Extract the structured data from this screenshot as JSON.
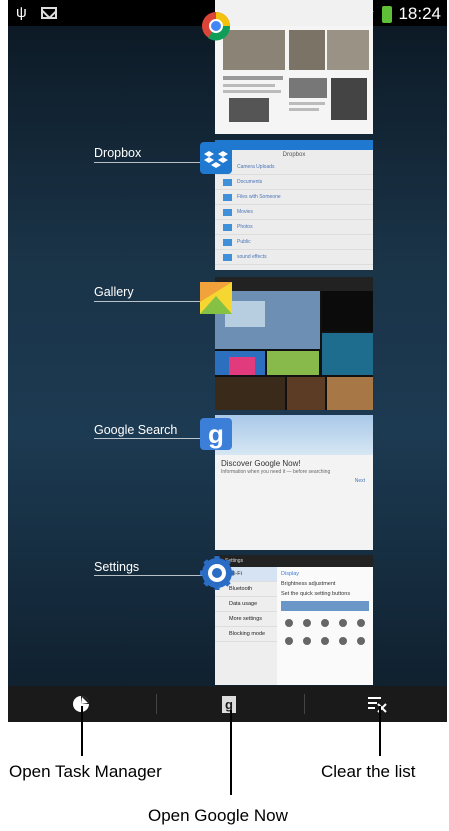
{
  "status_bar": {
    "time": "18:24"
  },
  "recent_apps": [
    {
      "label": "Dropbox"
    },
    {
      "label": "Gallery"
    },
    {
      "label": "Google Search"
    },
    {
      "label": "Settings"
    }
  ],
  "bottom_bar": {
    "google_glyph": "g"
  },
  "callouts": {
    "task_manager": "Open Task Manager",
    "google_now": "Open Google Now",
    "clear_list": "Clear the list"
  },
  "colors": {
    "accent_blue": "#2079d0",
    "battery_green": "#5fbf37",
    "bar_bg": "#1a1a1a"
  }
}
